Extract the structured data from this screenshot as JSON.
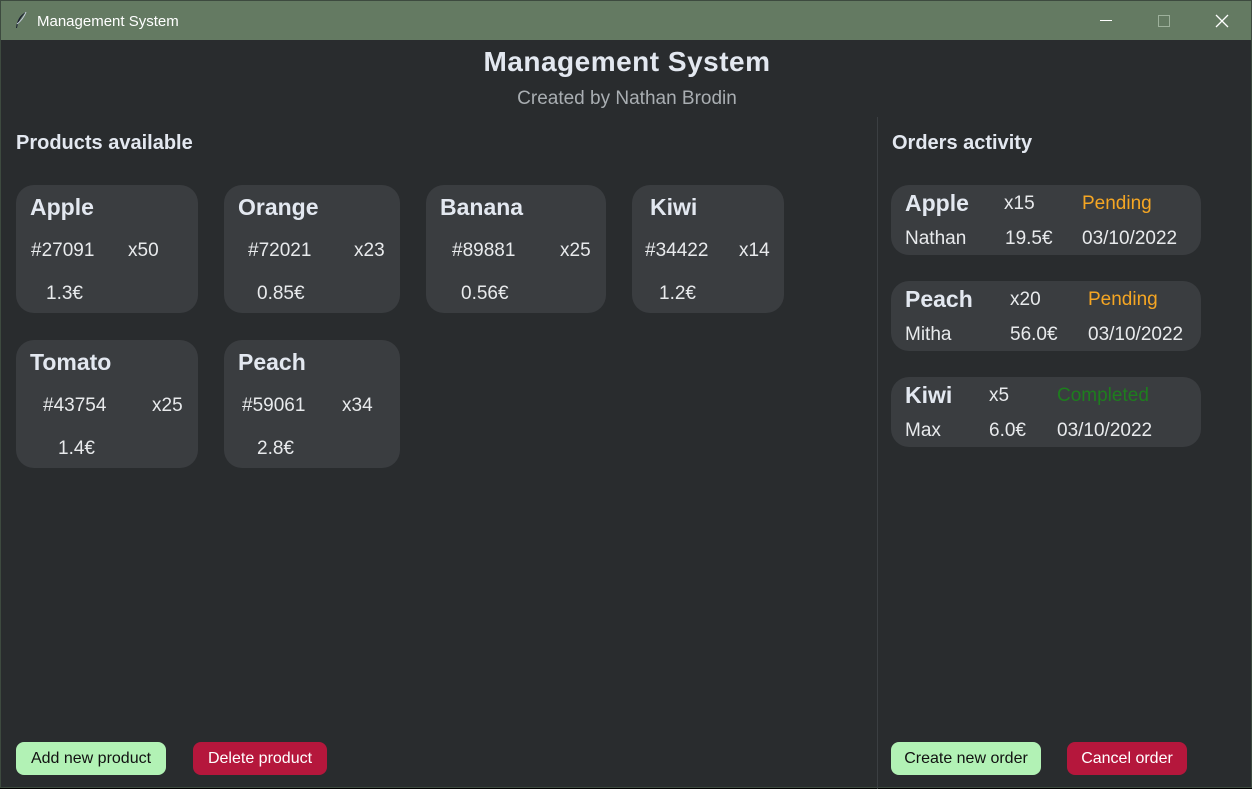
{
  "window": {
    "title": "Management System",
    "icons": [
      "feather-icon",
      "minimize-icon",
      "maximize-icon",
      "close-icon"
    ]
  },
  "header": {
    "title": "Management System",
    "subtitle": "Created by Nathan Brodin"
  },
  "products": {
    "heading": "Products available",
    "items": [
      {
        "name": "Apple",
        "code": "#27091",
        "qty": "x50",
        "price": "1.3€"
      },
      {
        "name": "Orange",
        "code": "#72021",
        "qty": "x23",
        "price": "0.85€"
      },
      {
        "name": "Banana",
        "code": "#89881",
        "qty": "x25",
        "price": "0.56€"
      },
      {
        "name": "Kiwi",
        "code": "#34422",
        "qty": "x14",
        "price": "1.2€"
      },
      {
        "name": "Tomato",
        "code": "#43754",
        "qty": "x25",
        "price": "1.4€"
      },
      {
        "name": "Peach",
        "code": "#59061",
        "qty": "x34",
        "price": "2.8€"
      }
    ],
    "add_label": "Add new product",
    "delete_label": "Delete product"
  },
  "orders": {
    "heading": "Orders activity",
    "items": [
      {
        "product": "Apple",
        "qty": "x15",
        "status": "Pending",
        "customer": "Nathan",
        "total": "19.5€",
        "date": "03/10/2022"
      },
      {
        "product": "Peach",
        "qty": "x20",
        "status": "Pending",
        "customer": "Mitha",
        "total": "56.0€",
        "date": "03/10/2022"
      },
      {
        "product": "Kiwi",
        "qty": "x5",
        "status": "Completed",
        "customer": "Max",
        "total": "6.0€",
        "date": "03/10/2022"
      }
    ],
    "create_label": "Create new order",
    "cancel_label": "Cancel order"
  },
  "colors": {
    "titlebar": "#647a62",
    "background": "#292c2e",
    "card": "#3a3d40",
    "pending": "#f5a623",
    "completed": "#1e7d1e",
    "green_button": "#b2f2b5",
    "red_button": "#b5173c"
  }
}
